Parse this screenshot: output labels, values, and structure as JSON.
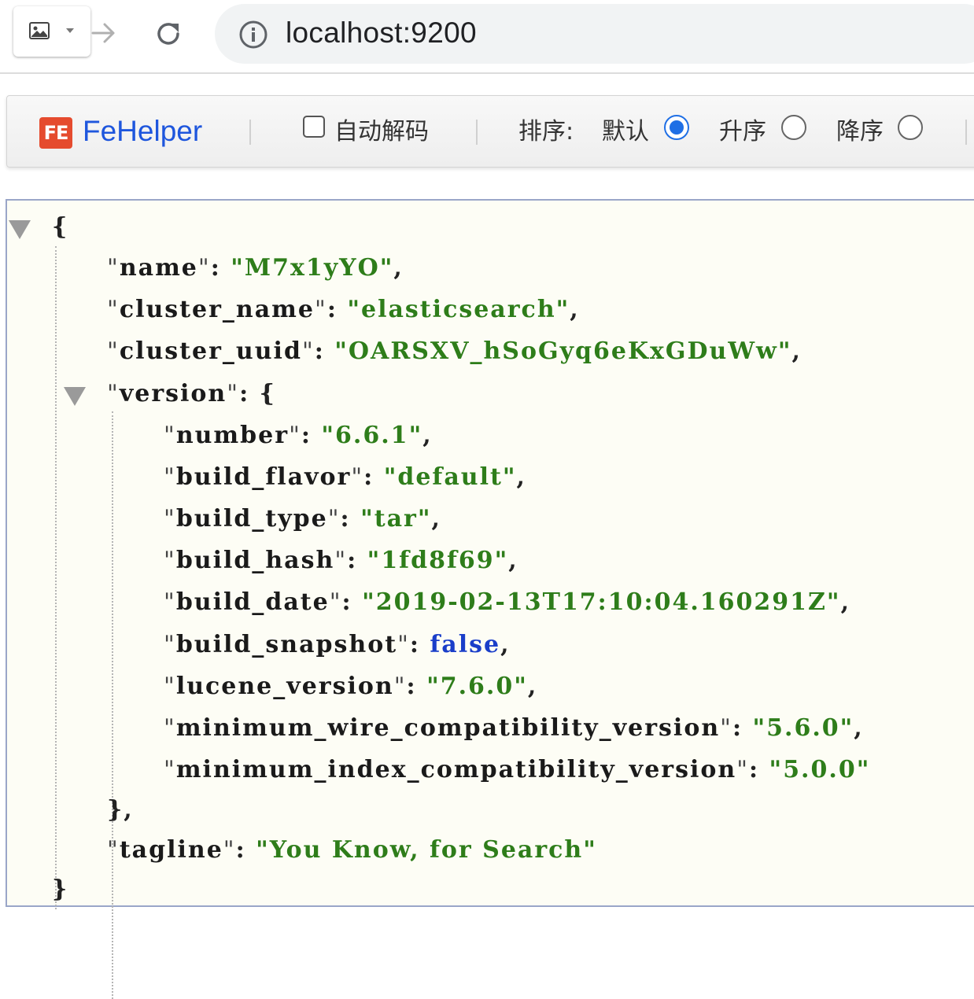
{
  "browser": {
    "url": "localhost:9200"
  },
  "fehelper": {
    "logo_text": "FE",
    "name": "FeHelper",
    "auto_decode_label": "自动解码",
    "auto_decode_checked": false,
    "sort_label": "排序:",
    "sort_default_label": "默认",
    "sort_asc_label": "升序",
    "sort_desc_label": "降序",
    "sort_selected": "默认"
  },
  "json": {
    "open_brace": "{",
    "close_brace": "}",
    "name": {
      "key": "name",
      "value": "M7x1yYO"
    },
    "cluster_name": {
      "key": "cluster_name",
      "value": "elasticsearch"
    },
    "cluster_uuid": {
      "key": "cluster_uuid",
      "value": "OARSXV_hSoGyq6eKxGDuWw"
    },
    "version": {
      "key": "version",
      "close": "},",
      "number": {
        "key": "number",
        "value": "6.6.1"
      },
      "build_flavor": {
        "key": "build_flavor",
        "value": "default"
      },
      "build_type": {
        "key": "build_type",
        "value": "tar"
      },
      "build_hash": {
        "key": "build_hash",
        "value": "1fd8f69"
      },
      "build_date": {
        "key": "build_date",
        "value": "2019-02-13T17:10:04.160291Z"
      },
      "build_snapshot": {
        "key": "build_snapshot",
        "value": "false"
      },
      "lucene_version": {
        "key": "lucene_version",
        "value": "7.6.0"
      },
      "minimum_wire_compatibility_version": {
        "key": "minimum_wire_compatibility_version",
        "value": "5.6.0"
      },
      "minimum_index_compatibility_version": {
        "key": "minimum_index_compatibility_version",
        "value": "5.0.0"
      }
    },
    "tagline": {
      "key": "tagline",
      "value": "You Know, for Search"
    }
  },
  "colors": {
    "key": "#1a1a1a",
    "string": "#2e7d1a",
    "boolean": "#1a3ec9",
    "fehelper_brand": "#1e56dd",
    "radio_selected": "#1f6fe5"
  }
}
